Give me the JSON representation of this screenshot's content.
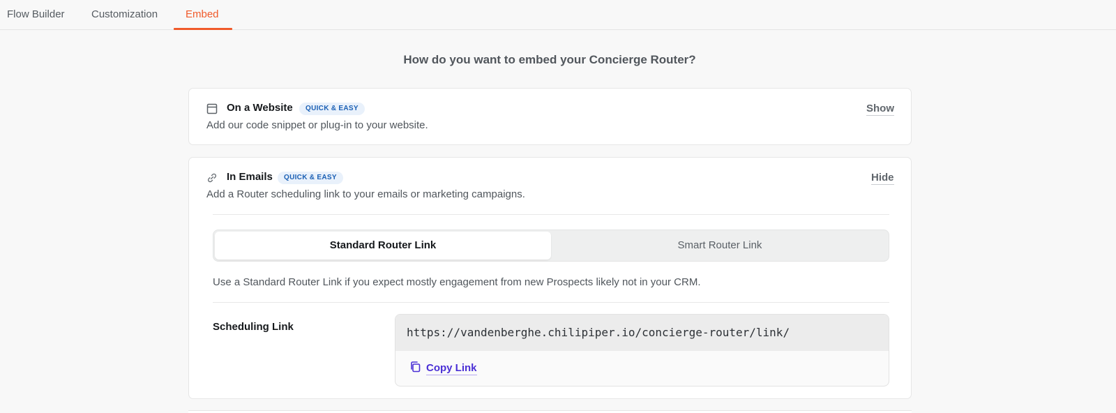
{
  "tabs": [
    {
      "label": "Flow Builder",
      "active": false
    },
    {
      "label": "Customization",
      "active": false
    },
    {
      "label": "Embed",
      "active": true
    }
  ],
  "page": {
    "heading": "How do you want to embed your Concierge Router?"
  },
  "colors": {
    "accent": "#f05a2a",
    "badge_bg": "#e9f1fb",
    "badge_text": "#1a5fb4",
    "link": "#4a2fd6"
  },
  "website_card": {
    "icon": "browser-window-icon",
    "title": "On a Website",
    "badge": "QUICK & EASY",
    "description": "Add our code snippet or plug-in to your website.",
    "toggle": "Show"
  },
  "email_card": {
    "icon": "link-icon",
    "title": "In Emails",
    "badge": "QUICK & EASY",
    "description": "Add a Router scheduling link to your emails or marketing campaigns.",
    "toggle": "Hide",
    "segmented": {
      "options": [
        "Standard Router Link",
        "Smart Router Link"
      ],
      "selected": "Standard Router Link"
    },
    "hint": "Use a Standard Router Link if you expect mostly engagement from new Prospects likely not in your CRM.",
    "scheduling": {
      "label": "Scheduling Link",
      "url": "https://vandenberghe.chilipiper.io/concierge-router/link/",
      "copy_icon": "copy-icon",
      "copy_label": "Copy Link"
    }
  }
}
